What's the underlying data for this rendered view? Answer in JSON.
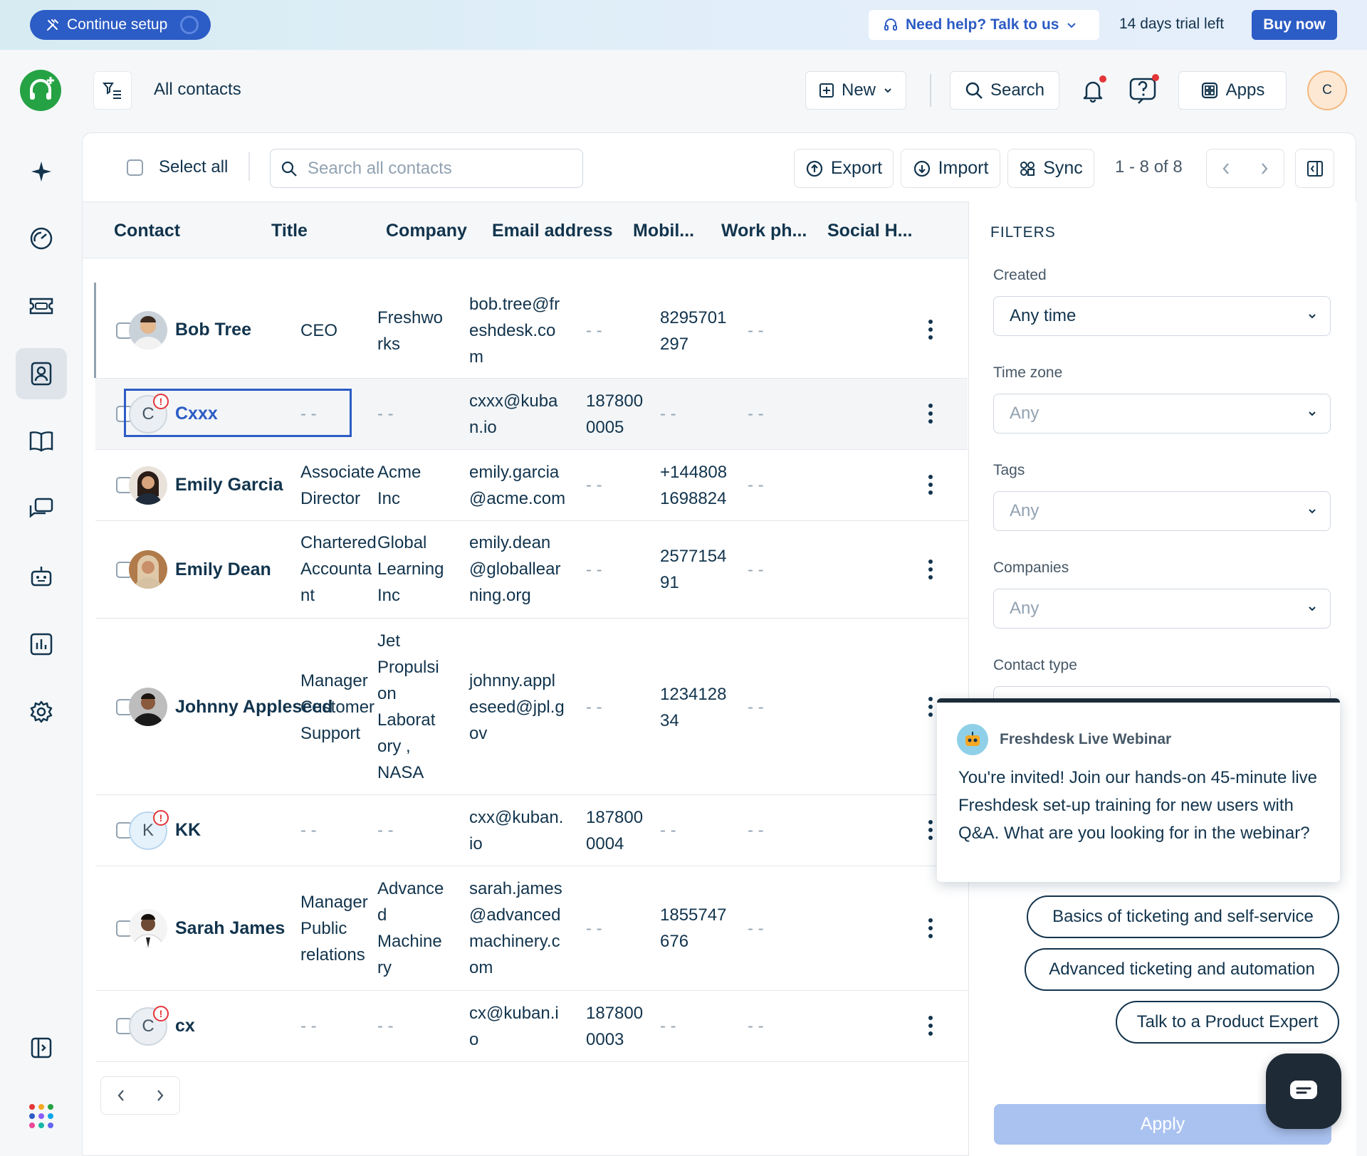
{
  "banner": {
    "continue_setup": "Continue setup",
    "need_help": "Need help? Talk to us",
    "trial": "14 days trial left",
    "buy_now": "Buy now"
  },
  "header": {
    "title": "All contacts",
    "new_label": "New",
    "search_label": "Search",
    "apps_label": "Apps",
    "avatar_letter": "C"
  },
  "toolbar": {
    "select_all": "Select all",
    "search_placeholder": "Search all contacts",
    "export": "Export",
    "import": "Import",
    "sync": "Sync",
    "pagination": "1 - 8 of 8"
  },
  "table": {
    "columns": [
      "Contact",
      "Title",
      "Company",
      "Email address",
      "Mobil...",
      "Work ph...",
      "Social H..."
    ],
    "rows": [
      {
        "name": "Bob Tree",
        "avatar": "photo",
        "title": [
          "CEO"
        ],
        "company": [
          "Freshwo",
          "rks"
        ],
        "email": [
          "bob.tree@fr",
          "eshdesk.co",
          "m"
        ],
        "mobile": [
          "- -"
        ],
        "work": [
          "8295701",
          "297"
        ],
        "social": "- -"
      },
      {
        "name": "Cxxx",
        "avatar": "C",
        "title": [
          "- -"
        ],
        "company": [
          "- -"
        ],
        "email": [
          "cxxx@kuba",
          "n.io"
        ],
        "mobile": [
          "187800",
          "0005"
        ],
        "work": [
          "- -"
        ],
        "social": "- -"
      },
      {
        "name": "Emily Garcia",
        "avatar": "photo",
        "title": [
          "Associate",
          "Director"
        ],
        "company": [
          "Acme",
          "Inc"
        ],
        "email": [
          "emily.garcia",
          "@acme.com"
        ],
        "mobile": [
          "- -"
        ],
        "work": [
          "+144808",
          "1698824"
        ],
        "social": "- -"
      },
      {
        "name": "Emily Dean",
        "avatar": "photo",
        "title": [
          "Chartered",
          "Accounta",
          "nt"
        ],
        "company": [
          "Global",
          "Learning",
          "Inc"
        ],
        "email": [
          "emily.dean",
          "@globallear",
          "ning.org"
        ],
        "mobile": [
          "- -"
        ],
        "work": [
          "2577154",
          "91"
        ],
        "social": "- -"
      },
      {
        "name": "Johnny Appleseed",
        "avatar": "photo",
        "title": [
          "Manager",
          "Customer",
          "Support"
        ],
        "company": [
          "Jet",
          "Propulsi",
          "on",
          "Laborat",
          "ory ,",
          "NASA"
        ],
        "email": [
          "johnny.appl",
          "eseed@jpl.g",
          "ov"
        ],
        "mobile": [
          "- -"
        ],
        "work": [
          "1234128",
          "34"
        ],
        "social": "- -"
      },
      {
        "name": "KK",
        "avatar": "K",
        "title": [
          "- -"
        ],
        "company": [
          "- -"
        ],
        "email": [
          "cxx@kuban.",
          "io"
        ],
        "mobile": [
          "187800",
          "0004"
        ],
        "work": [
          "- -"
        ],
        "social": "- -"
      },
      {
        "name": "Sarah James",
        "avatar": "photo",
        "title": [
          "Manager",
          "Public",
          "relations"
        ],
        "company": [
          "Advance",
          "d",
          "Machine",
          "ry"
        ],
        "email": [
          "sarah.james",
          "@advanced",
          "machinery.c",
          "om"
        ],
        "mobile": [
          "- -"
        ],
        "work": [
          "1855747",
          "676"
        ],
        "social": "- -"
      },
      {
        "name": "cx",
        "avatar": "C",
        "title": [
          "- -"
        ],
        "company": [
          "- -"
        ],
        "email": [
          "cx@kuban.i",
          "o"
        ],
        "mobile": [
          "187800",
          "0003"
        ],
        "work": [
          "- -"
        ],
        "social": "- -"
      }
    ]
  },
  "filters": {
    "heading": "FILTERS",
    "created_label": "Created",
    "created_value": "Any time",
    "timezone_label": "Time zone",
    "timezone_value": "Any",
    "tags_label": "Tags",
    "tags_value": "Any",
    "companies_label": "Companies",
    "companies_value": "Any",
    "contact_type_label": "Contact type",
    "apply": "Apply"
  },
  "webinar": {
    "title": "Freshdesk Live Webinar",
    "body": "You're invited! Join our hands-on 45-minute live Freshdesk set-up training for new users with Q&A. What are you looking for in the webinar?",
    "options": [
      "Basics of ticketing and self-service",
      "Advanced ticketing and automation",
      "Talk to a Product Expert"
    ]
  },
  "colors": {
    "brand_blue": "#2c5cc5",
    "text_primary": "#12344d",
    "alert_red": "#e43538",
    "logo_green": "#25a244"
  }
}
